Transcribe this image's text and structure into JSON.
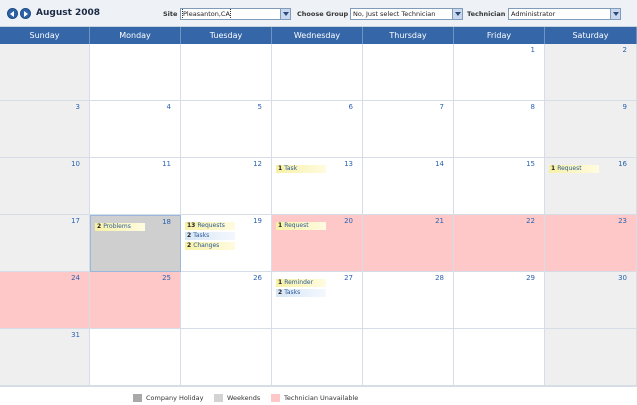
{
  "header": {
    "month_title": "August 2008",
    "site_label": "Site",
    "site_value": "Pleasanton,CA",
    "group_label": "Choose Group",
    "group_value": "No, Just select Technician",
    "technician_label": "Technician",
    "technician_value": "Administrator"
  },
  "days": [
    "Sunday",
    "Monday",
    "Tuesday",
    "Wednesday",
    "Thursday",
    "Friday",
    "Saturday"
  ],
  "weeks": [
    [
      {
        "n": "",
        "t": "weekend"
      },
      {
        "n": "",
        "t": ""
      },
      {
        "n": "",
        "t": ""
      },
      {
        "n": "",
        "t": ""
      },
      {
        "n": "",
        "t": ""
      },
      {
        "n": "1",
        "t": ""
      },
      {
        "n": "2",
        "t": "weekend"
      }
    ],
    [
      {
        "n": "3",
        "t": "weekend"
      },
      {
        "n": "4",
        "t": ""
      },
      {
        "n": "5",
        "t": ""
      },
      {
        "n": "6",
        "t": ""
      },
      {
        "n": "7",
        "t": ""
      },
      {
        "n": "8",
        "t": ""
      },
      {
        "n": "9",
        "t": "weekend"
      }
    ],
    [
      {
        "n": "10",
        "t": "weekend"
      },
      {
        "n": "11",
        "t": ""
      },
      {
        "n": "12",
        "t": ""
      },
      {
        "n": "13",
        "t": "",
        "events": [
          {
            "count": "1",
            "label": "Task",
            "color": "yellow"
          }
        ]
      },
      {
        "n": "14",
        "t": ""
      },
      {
        "n": "15",
        "t": ""
      },
      {
        "n": "16",
        "t": "weekend",
        "events": [
          {
            "count": "1",
            "label": "Request",
            "color": "yellow"
          }
        ]
      }
    ],
    [
      {
        "n": "17",
        "t": "weekend"
      },
      {
        "n": "18",
        "t": "holiday",
        "events": [
          {
            "count": "2",
            "label": "Problems",
            "color": "yellow"
          }
        ]
      },
      {
        "n": "19",
        "t": "",
        "events": [
          {
            "count": "13",
            "label": "Requests",
            "color": "yellow"
          },
          {
            "count": "2",
            "label": "Tasks",
            "color": "blue"
          },
          {
            "count": "2",
            "label": "Changes",
            "color": "yellow"
          }
        ]
      },
      {
        "n": "20",
        "t": "unavail",
        "events": [
          {
            "count": "1",
            "label": "Request",
            "color": "yellow"
          }
        ]
      },
      {
        "n": "21",
        "t": "unavail"
      },
      {
        "n": "22",
        "t": "unavail"
      },
      {
        "n": "23",
        "t": "unavail"
      }
    ],
    [
      {
        "n": "24",
        "t": "unavail"
      },
      {
        "n": "25",
        "t": "unavail"
      },
      {
        "n": "26",
        "t": ""
      },
      {
        "n": "27",
        "t": "",
        "events": [
          {
            "count": "1",
            "label": "Reminder",
            "color": "yellow"
          },
          {
            "count": "2",
            "label": "Tasks",
            "color": "blue"
          }
        ]
      },
      {
        "n": "28",
        "t": ""
      },
      {
        "n": "29",
        "t": ""
      },
      {
        "n": "30",
        "t": "weekend"
      }
    ],
    [
      {
        "n": "31",
        "t": "weekend"
      },
      {
        "n": "",
        "t": ""
      },
      {
        "n": "",
        "t": ""
      },
      {
        "n": "",
        "t": ""
      },
      {
        "n": "",
        "t": ""
      },
      {
        "n": "",
        "t": ""
      },
      {
        "n": "",
        "t": "weekend"
      }
    ]
  ],
  "legend": [
    {
      "label": "Company Holiday",
      "color": "#a9a9a9"
    },
    {
      "label": "Weekends",
      "color": "#d3d3d3"
    },
    {
      "label": "Technician Unavailable",
      "color": "#ffc8c8"
    }
  ],
  "icons": {
    "prev": "arrow-left-icon",
    "next": "arrow-right-icon",
    "dropdown": "chevron-down-icon"
  }
}
